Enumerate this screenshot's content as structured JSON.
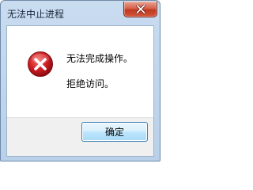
{
  "window": {
    "title": "无法中止进程",
    "close_icon": "close-icon"
  },
  "dialog": {
    "icon": "error-icon",
    "message_primary": "无法完成操作。",
    "message_secondary": "拒绝访问。"
  },
  "buttons": {
    "ok_label": "确定"
  },
  "colors": {
    "title_bar": "#c1d6ee",
    "close_button": "#c9452b",
    "error_icon": "#d31f25",
    "ok_button_border": "#3c7fb1"
  }
}
